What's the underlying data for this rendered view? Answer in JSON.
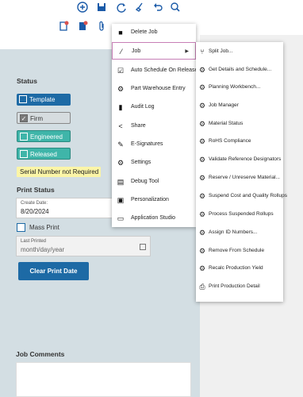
{
  "toolbar": {
    "icons": [
      "add-icon",
      "save-icon",
      "refresh-icon",
      "clear-icon",
      "undo-icon",
      "search-icon"
    ],
    "row2_icons": [
      "new-doc-icon",
      "doc-icon",
      "attachment-icon",
      "more-icon"
    ]
  },
  "status": {
    "heading": "Status",
    "template_label": "Template",
    "firm_label": "Firm",
    "engineered_label": "Engineered",
    "released_label": "Released",
    "serial_badge": "Serial Number not Required"
  },
  "print_status": {
    "heading": "Print Status",
    "create_date_label": "Create Date:",
    "create_date_value": "8/20/2024",
    "mass_print_label": "Mass Print",
    "last_printed_label": "Last Printed",
    "last_printed_placeholder": "month/day/year",
    "clear_button": "Clear Print Date"
  },
  "comments": {
    "heading": "Job Comments"
  },
  "menu": {
    "items": [
      {
        "label": "Delete Job",
        "icon": "trash-icon"
      },
      {
        "label": "Job",
        "icon": "link-icon"
      },
      {
        "label": "Auto Schedule On Release",
        "icon": "checkbox-icon"
      },
      {
        "label": "Part Warehouse Entry",
        "icon": "gears-icon"
      },
      {
        "label": "Audit Log",
        "icon": "doc-icon"
      },
      {
        "label": "Share",
        "icon": "share-icon"
      },
      {
        "label": "E-Signatures",
        "icon": "signature-icon"
      },
      {
        "label": "Settings",
        "icon": "gear-icon"
      },
      {
        "label": "Debug Tool",
        "icon": "debug-icon"
      },
      {
        "label": "Personalization",
        "icon": "image-icon"
      },
      {
        "label": "Application Studio",
        "icon": "monitor-icon"
      }
    ]
  },
  "submenu": {
    "items": [
      {
        "label": "Split Job...",
        "icon": "split-icon"
      },
      {
        "label": "Get Details and Schedule...",
        "icon": "gears-icon"
      },
      {
        "label": "Planning Workbench...",
        "icon": "gears-icon"
      },
      {
        "label": "Job Manager",
        "icon": "gears-icon"
      },
      {
        "label": "Material Status",
        "icon": "gears-icon"
      },
      {
        "label": "RoHS Compliance",
        "icon": "gears-icon"
      },
      {
        "label": "Validate Reference Designators",
        "icon": "gears-icon"
      },
      {
        "label": "Reserve / Unreserve Material...",
        "icon": "gears-icon"
      },
      {
        "label": "Suspend Cost and Quality Rollups",
        "icon": "gears-icon"
      },
      {
        "label": "Process Suspended Rollups",
        "icon": "gears-icon"
      },
      {
        "label": "Assign ID Numbers...",
        "icon": "gears-icon"
      },
      {
        "label": "Remove From Schedule",
        "icon": "gears-icon"
      },
      {
        "label": "Recalc Production Yield",
        "icon": "gears-icon"
      },
      {
        "label": "Print Production Detail",
        "icon": "printer-icon"
      }
    ]
  }
}
